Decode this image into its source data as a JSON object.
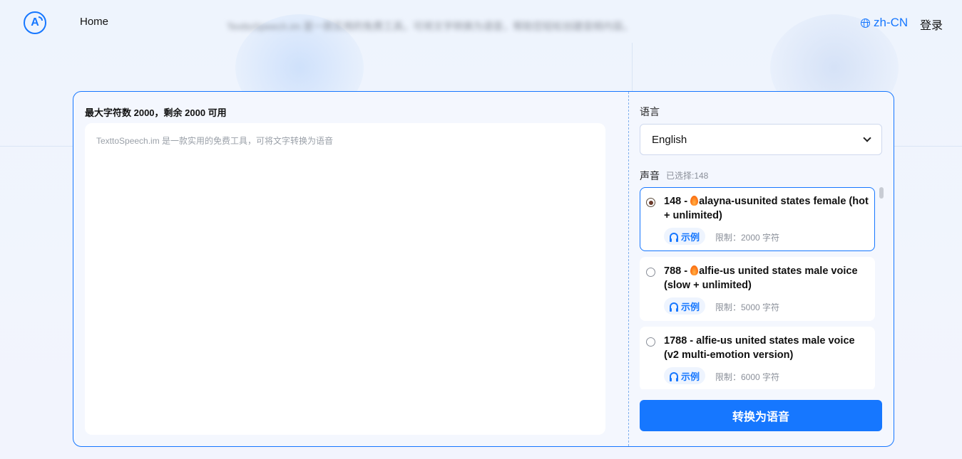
{
  "header": {
    "logo_letter": "A",
    "nav_home": "Home",
    "tagline": "TexttoSpeech.im 是一款实用的免费工具，可将文字转换为语音，帮助您轻松创建音频内容。",
    "language": "zh-CN",
    "login": "登录"
  },
  "editor": {
    "char_count": "最大字符数 2000，剩余 2000 可用",
    "placeholder": "TexttoSpeech.im 是一款实用的免费工具，可将文字转换为语音"
  },
  "settings": {
    "language_label": "语言",
    "language_selected": "English",
    "voice_label": "声音",
    "voice_selected_count": "已选择:148",
    "voices": [
      {
        "id": "148 - ",
        "hot": true,
        "name": "alayna-usunited states female (hot + unlimited)",
        "sample_label": "示例",
        "limit": "限制：2000 字符",
        "selected": true
      },
      {
        "id": "788 - ",
        "hot": true,
        "name": "alfie-us united states male voice (slow + unlimited)",
        "sample_label": "示例",
        "limit": "限制：5000 字符",
        "selected": false
      },
      {
        "id": "1788 - ",
        "hot": false,
        "name": "alfie-us united states male voice (v2 multi-emotion version)",
        "sample_label": "示例",
        "limit": "限制：6000 字符",
        "selected": false
      }
    ],
    "convert_button": "转换为语音"
  },
  "colors": {
    "accent": "#1677ff",
    "background": "#eef4fd"
  }
}
